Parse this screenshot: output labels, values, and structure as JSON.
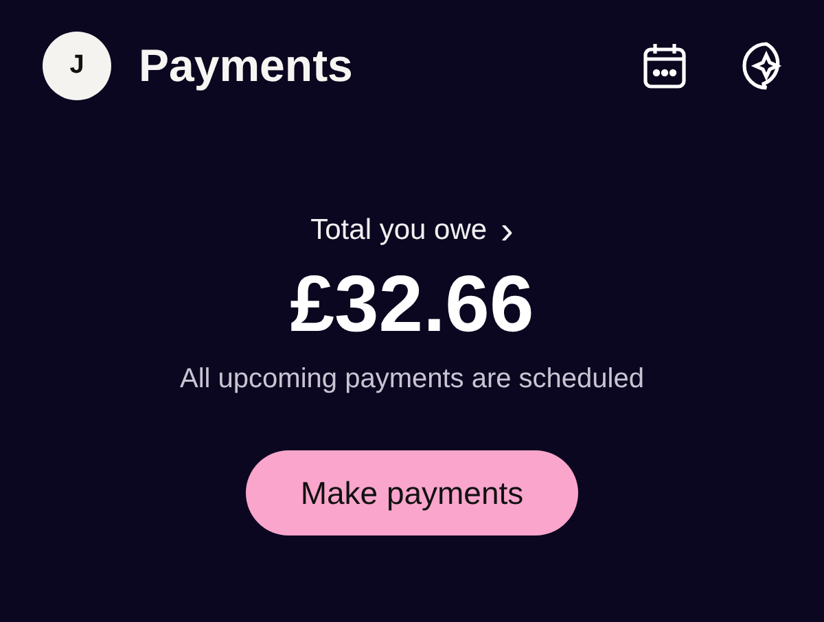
{
  "header": {
    "avatar": "J",
    "title": "Payments"
  },
  "summary": {
    "label": "Total you owe",
    "chevron": "›",
    "amount": "£32.66",
    "note": "All upcoming payments are scheduled"
  },
  "button": "Make payments"
}
